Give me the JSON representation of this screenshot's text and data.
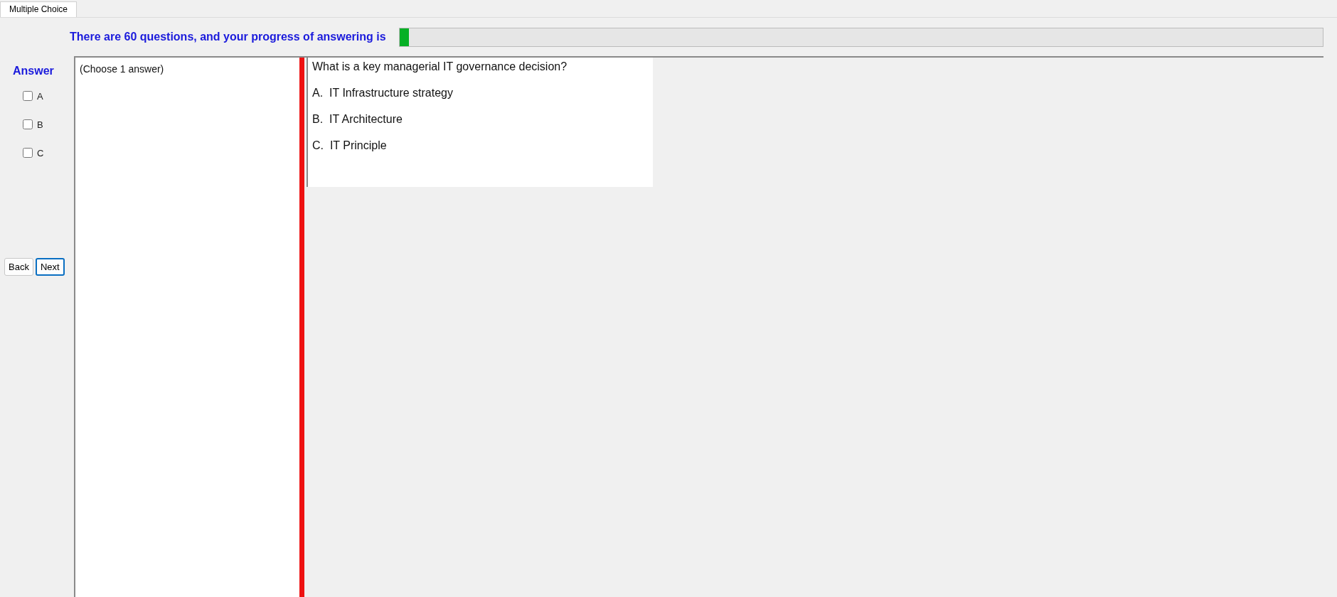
{
  "tab": {
    "label": "Multiple Choice",
    "selected": true
  },
  "progress": {
    "label": "There are 60 questions, and your progress of answering is",
    "level": 0.01
  },
  "answer": {
    "title": "Answer",
    "options": [
      {
        "label": "A",
        "checked": false
      },
      {
        "label": "B",
        "checked": false
      },
      {
        "label": "C",
        "checked": false
      }
    ]
  },
  "buttons": [
    {
      "label": "Back",
      "focused": false
    },
    {
      "label": "Next",
      "focused": true
    }
  ],
  "instruction": "(Choose 1 answer)",
  "question": {
    "text": "What is a key managerial IT governance decision?",
    "choices": [
      "A.  IT Infrastructure strategy",
      "B.  IT Architecture",
      "C.  IT Principle"
    ]
  }
}
